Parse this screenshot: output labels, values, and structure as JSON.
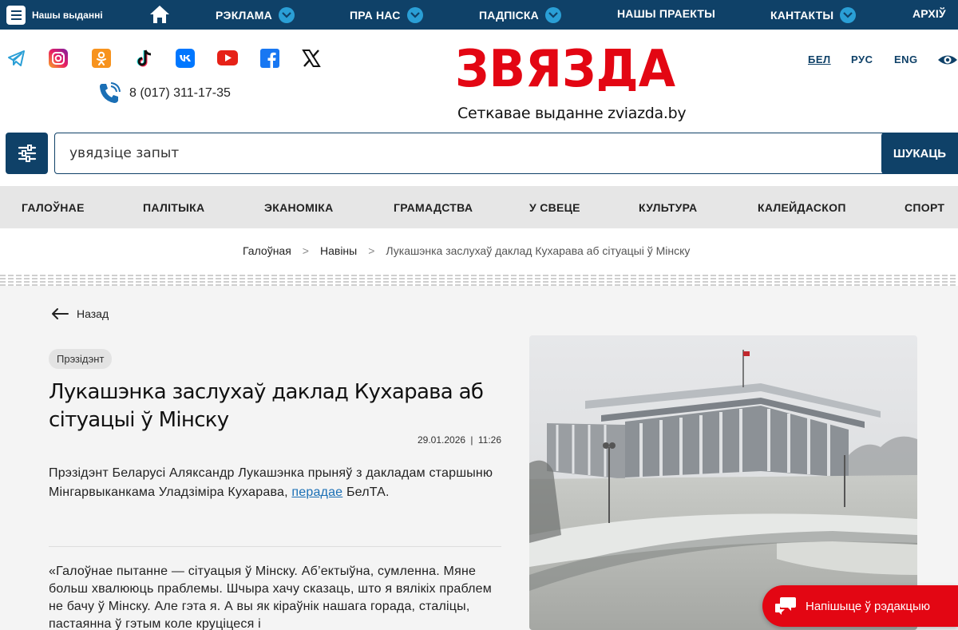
{
  "topbar": {
    "editions_label": "Нашы выданні",
    "items": [
      {
        "label": "РЭКЛАМА"
      },
      {
        "label": "ПРА НАС"
      },
      {
        "label": "ПАДПІСКА"
      },
      {
        "label": "НАШЫ ПРАЕКТЫ"
      },
      {
        "label": "КАНТАКТЫ"
      },
      {
        "label": "АРХІЎ"
      }
    ]
  },
  "header": {
    "social_icons": [
      "telegram-icon",
      "instagram-icon",
      "odnoklassniki-icon",
      "tiktok-icon",
      "vk-icon",
      "youtube-icon",
      "facebook-icon",
      "x-icon"
    ],
    "phone": "8 (017) 311-17-35",
    "logo_text": "ЗВЯЗДА",
    "tagline": "Сеткавае выданне zviazda.by",
    "languages": [
      {
        "label": "БЕЛ",
        "active": true
      },
      {
        "label": "РУС"
      },
      {
        "label": "ENG"
      }
    ]
  },
  "search": {
    "placeholder": "увядзіце запыт",
    "button_label": "ШУКАЦЬ"
  },
  "sections": [
    "ГАЛОЎНАЕ",
    "ПАЛІТЫКА",
    "ЭКАНОМІКА",
    "ГРАМАДСТВА",
    "У СВЕЦЕ",
    "КУЛЬТУРА",
    "КАЛЕЙДАСКОП",
    "СПОРТ"
  ],
  "breadcrumb": {
    "home": "Галоўная",
    "news": "Навіны",
    "current": "Лукашэнка заслухаў даклад Кухарава аб сітуацыі ў Мінску",
    "separator": ">"
  },
  "article": {
    "back_label": "Назад",
    "tag": "Прэзідэнт",
    "title": "Лукашэнка заслухаў даклад Кухарава аб сітуацыі ў Мінску",
    "date": "29.01.2026",
    "time": "11:26",
    "lead_before": "Прэзідэнт Беларусі Аляксандр Лукашэнка прыняў з дакладам старшыню Мінгарвыканкама Уладзіміра Кухарава, ",
    "lead_link": "перадае",
    "lead_after": " БелТА.",
    "quote": "«Галоўнае пытанне — сітуацыя ў Мінску. Аб’ектыўна, сумленна. Мяне больш хвалююць праблемы. Шчыра хачу сказаць, што я вялікіх праблем не бачу ў Мінску. Але гэта я. А вы як кіраўнік нашага горада, сталіцы, пастаянна ў гэтым коле круціцеся і"
  },
  "write_button": {
    "label": "Напішыце ў рэдакцыю"
  },
  "colors": {
    "primary": "#0f4168",
    "accent": "#2a9fd6",
    "brand_red": "#e30613"
  }
}
